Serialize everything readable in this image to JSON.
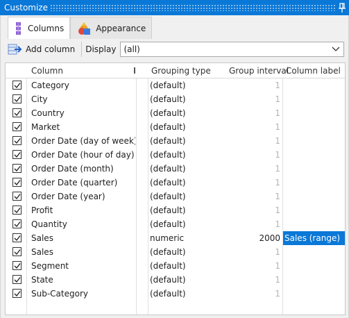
{
  "window": {
    "title": "Customize"
  },
  "tabs": [
    {
      "label": "Columns",
      "icon": "columns-icon",
      "active": true
    },
    {
      "label": "Appearance",
      "icon": "appearance-icon",
      "active": false
    }
  ],
  "toolbar": {
    "add_column_label": "Add column",
    "display_label": "Display",
    "display_value": "(all)"
  },
  "grid": {
    "headers": {
      "column": "Column",
      "grouping_type": "Grouping type",
      "group_interval": "Group interval",
      "column_label": "Column label"
    },
    "rows": [
      {
        "checked": true,
        "column": "Category",
        "grouping_type": "(default)",
        "group_interval": "1",
        "column_label": ""
      },
      {
        "checked": true,
        "column": "City",
        "grouping_type": "(default)",
        "group_interval": "1",
        "column_label": ""
      },
      {
        "checked": true,
        "column": "Country",
        "grouping_type": "(default)",
        "group_interval": "1",
        "column_label": ""
      },
      {
        "checked": true,
        "column": "Market",
        "grouping_type": "(default)",
        "group_interval": "1",
        "column_label": ""
      },
      {
        "checked": true,
        "column": "Order Date (day of week)",
        "grouping_type": "(default)",
        "group_interval": "1",
        "column_label": ""
      },
      {
        "checked": true,
        "column": "Order Date (hour of day)",
        "grouping_type": "(default)",
        "group_interval": "1",
        "column_label": ""
      },
      {
        "checked": true,
        "column": "Order Date (month)",
        "grouping_type": "(default)",
        "group_interval": "1",
        "column_label": ""
      },
      {
        "checked": true,
        "column": "Order Date (quarter)",
        "grouping_type": "(default)",
        "group_interval": "1",
        "column_label": ""
      },
      {
        "checked": true,
        "column": "Order Date (year)",
        "grouping_type": "(default)",
        "group_interval": "1",
        "column_label": ""
      },
      {
        "checked": true,
        "column": "Profit",
        "grouping_type": "(default)",
        "group_interval": "1",
        "column_label": ""
      },
      {
        "checked": true,
        "column": "Quantity",
        "grouping_type": "(default)",
        "group_interval": "1",
        "column_label": ""
      },
      {
        "checked": true,
        "column": "Sales",
        "grouping_type": "numeric",
        "group_interval": "2000",
        "column_label": "Sales (range)"
      },
      {
        "checked": true,
        "column": "Sales",
        "grouping_type": "(default)",
        "group_interval": "1",
        "column_label": ""
      },
      {
        "checked": true,
        "column": "Segment",
        "grouping_type": "(default)",
        "group_interval": "1",
        "column_label": ""
      },
      {
        "checked": true,
        "column": "State",
        "grouping_type": "(default)",
        "group_interval": "1",
        "column_label": ""
      },
      {
        "checked": true,
        "column": "Sub-Category",
        "grouping_type": "(default)",
        "group_interval": "1",
        "column_label": ""
      }
    ]
  },
  "colors": {
    "accent": "#0a78d7",
    "disabled_text": "#b4b4b4"
  }
}
